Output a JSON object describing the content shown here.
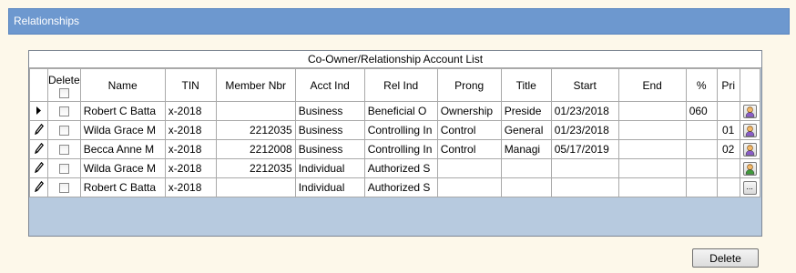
{
  "window": {
    "title": "Relationships"
  },
  "grid": {
    "caption": "Co-Owner/Relationship Account List",
    "headers": {
      "delete": "Delete",
      "name": "Name",
      "tin": "TIN",
      "member_nbr": "Member Nbr",
      "acct_ind": "Acct Ind",
      "rel_ind": "Rel Ind",
      "prong": "Prong",
      "title": "Title",
      "start": "Start",
      "end": "End",
      "pct": "%",
      "pri": "Pri"
    },
    "rows": [
      {
        "selector": "current-row-arrow",
        "delete_checked": false,
        "name": "Robert C Batta",
        "tin": "x-2018",
        "member_nbr": "",
        "acct_ind": "Business",
        "rel_ind": "Beneficial O",
        "prong": "Ownership",
        "title": "Preside",
        "start": "01/23/2018",
        "end": "",
        "pct": "060",
        "pri": "",
        "button_icon": "person-purple-icon"
      },
      {
        "selector": "edit-pencil",
        "delete_checked": false,
        "name": "Wilda Grace M",
        "tin": "x-2018",
        "member_nbr": "2212035",
        "acct_ind": "Business",
        "rel_ind": "Controlling In",
        "prong": "Control",
        "title": "General",
        "start": "01/23/2018",
        "end": "",
        "pct": "",
        "pri": "01",
        "button_icon": "person-purple-icon"
      },
      {
        "selector": "edit-pencil",
        "delete_checked": false,
        "name": "Becca Anne M",
        "tin": "x-2018",
        "member_nbr": "2212008",
        "acct_ind": "Business",
        "rel_ind": "Controlling In",
        "prong": "Control",
        "title": "Managi",
        "start": "05/17/2019",
        "end": "",
        "pct": "",
        "pri": "02",
        "button_icon": "person-purple-icon"
      },
      {
        "selector": "edit-pencil",
        "delete_checked": false,
        "name": "Wilda Grace M",
        "tin": "x-2018",
        "member_nbr": "2212035",
        "acct_ind": "Individual",
        "rel_ind": "Authorized S",
        "prong": "",
        "title": "",
        "start": "",
        "end": "",
        "pct": "",
        "pri": "",
        "button_icon": "person-green-icon"
      },
      {
        "selector": "edit-pencil",
        "delete_checked": false,
        "name": "Robert C Batta",
        "tin": "x-2018",
        "member_nbr": "",
        "acct_ind": "Individual",
        "rel_ind": "Authorized S",
        "prong": "",
        "title": "",
        "start": "",
        "end": "",
        "pct": "",
        "pri": "",
        "button_icon": "ellipsis-icon",
        "button_label": "..."
      }
    ]
  },
  "footer": {
    "delete_label": "Delete"
  },
  "colors": {
    "titlebar": "#6d98cf",
    "background": "#fdf8ea",
    "grid_empty_area": "#b7cadf",
    "person_purple": "#8a5cc9",
    "person_green": "#3f9a3a",
    "person_face": "#f2b86a"
  }
}
